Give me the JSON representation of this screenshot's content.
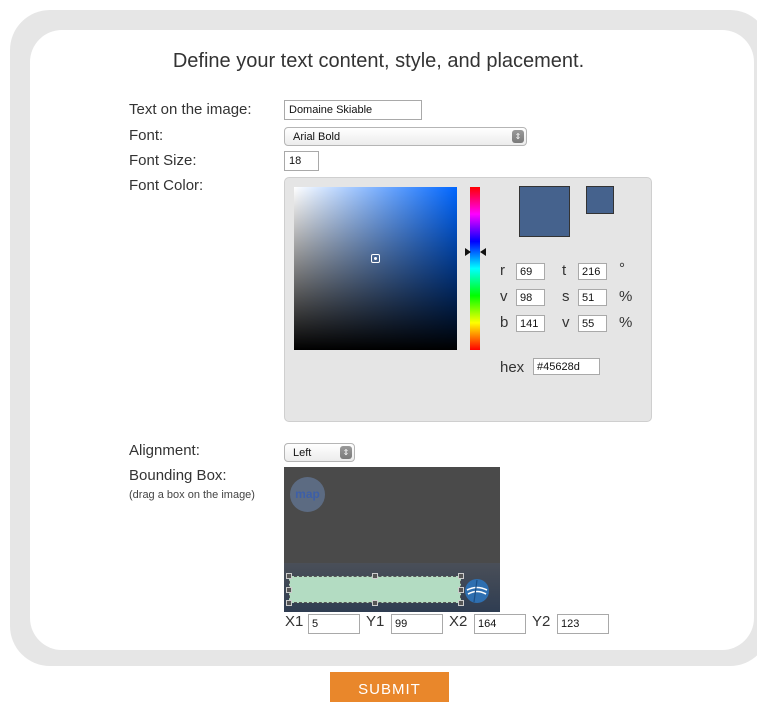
{
  "heading": "Define your text content, style, and placement.",
  "form": {
    "text_label": "Text on the image:",
    "text_value": "Domaine Skiable",
    "font_label": "Font:",
    "font_value": "Arial Bold",
    "font_size_label": "Font Size:",
    "font_size_value": "18",
    "font_color_label": "Font Color:",
    "alignment_label": "Alignment:",
    "alignment_value": "Left",
    "bbox_label": "Bounding Box:",
    "bbox_hint": "(drag a box on the image)"
  },
  "color_picker": {
    "r_label": "r",
    "r_value": "69",
    "v1_label": "v",
    "v1_value": "98",
    "b_label": "b",
    "b_value": "141",
    "t_label": "t",
    "t_value": "216",
    "t_unit": "°",
    "s_label": "s",
    "s_value": "51",
    "s_unit": "%",
    "v2_label": "v",
    "v2_value": "55",
    "v2_unit": "%",
    "hex_label": "hex",
    "hex_value": "#45628d",
    "selected_color": "#45628d",
    "previous_color": "#45628d"
  },
  "preview": {
    "logo_text": "map"
  },
  "bbox": {
    "x1_label": "X1",
    "x1_value": "5",
    "y1_label": "Y1",
    "y1_value": "99",
    "x2_label": "X2",
    "x2_value": "164",
    "y2_label": "Y2",
    "y2_value": "123"
  },
  "submit_label": "SUBMIT",
  "colors": {
    "accent": "#e9872b",
    "panel_bg": "#e6e6e6",
    "bbox_fill": "#b3dcc2"
  }
}
